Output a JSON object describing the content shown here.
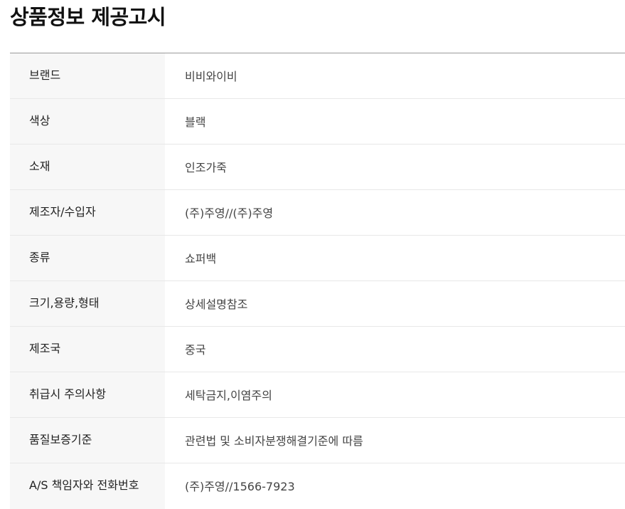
{
  "page": {
    "title": "상품정보 제공고시"
  },
  "rows": [
    {
      "label": "브랜드",
      "value": "비비와이비"
    },
    {
      "label": "색상",
      "value": "블랙"
    },
    {
      "label": "소재",
      "value": "인조가죽"
    },
    {
      "label": "제조자/수입자",
      "value": "(주)주영//(주)주영"
    },
    {
      "label": "종류",
      "value": "쇼퍼백"
    },
    {
      "label": "크기,용량,형태",
      "value": "상세설명참조"
    },
    {
      "label": "제조국",
      "value": "중국"
    },
    {
      "label": "취급시 주의사항",
      "value": "세탁금지,이염주의"
    },
    {
      "label": "품질보증기준",
      "value": "관련법 및 소비자분쟁해결기준에 따름"
    },
    {
      "label": "A/S 책임자와 전화번호",
      "value": "(주)주영//1566-7923"
    }
  ]
}
